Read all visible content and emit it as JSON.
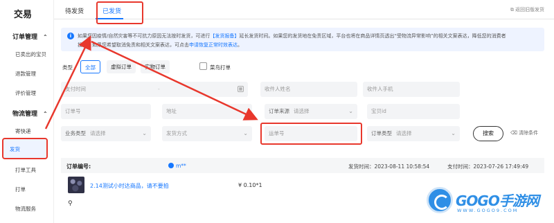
{
  "sidebar": {
    "title": "交易",
    "groups": [
      {
        "label": "订单管理",
        "items": [
          "已卖出的宝贝",
          "退款管理",
          "评价管理"
        ]
      },
      {
        "label": "物流管理",
        "items": [
          "寄快递",
          "发货",
          "打单工具",
          "打单",
          "物流服务"
        ]
      }
    ],
    "active_item": "发货"
  },
  "tabs": [
    {
      "label": "待发货",
      "active": false
    },
    {
      "label": "已发货",
      "active": true
    }
  ],
  "back_link": "返回旧版发货",
  "notice": {
    "line1_pre": "如果您因疫情/自然灾害等不可抗力原因无法按时发货，可进行",
    "line1_link": "【发货报备】",
    "line1_post": "延长发货时间。如果您的发货地在免责区域，平台也将在商品详情页透出“受物流异常影响”的相关文案表达，降低您的消费者",
    "line2_pre": "投诉。如果您希望取消免责和相关文案表达，可点击",
    "line2_link": "申请恢复正常时效表达",
    "line2_post": "。"
  },
  "filters": {
    "type_label": "类型",
    "type_options": [
      "全部",
      "虚拟订单",
      "实物订单"
    ],
    "type_selected": "全部",
    "cainiao_label": "菜鸟打单",
    "pay_time_placeholder": "支付时间",
    "recipient_name": "收件人姓名",
    "recipient_phone": "收件人手机",
    "order_no": "订单号",
    "address": "地址",
    "order_source_label": "订单来源",
    "select_placeholder": "请选择",
    "item_id": "宝贝id",
    "business_type_label": "业务类型",
    "ship_method": "发货方式",
    "tracking_no": "运单号",
    "order_type_label": "订单类型",
    "search_label": "搜索",
    "clear_label": "清除条件"
  },
  "order": {
    "no_label": "订单编号:",
    "buyer": "m**",
    "ship_time": "发货时间：2023-08-11 10:58:54",
    "pay_time": "支付时间：2023-07-26 17:49:49",
    "product_title": "2.14测试小时达商品，请不要拍",
    "price": "¥ 0.10*1"
  },
  "watermark": {
    "brand": "GOGO手游网",
    "url": "WWW.GOGO9.COM"
  },
  "colors": {
    "accent": "#1677ff",
    "highlight": "#e8372c",
    "notice_bg": "#eef3ff"
  }
}
